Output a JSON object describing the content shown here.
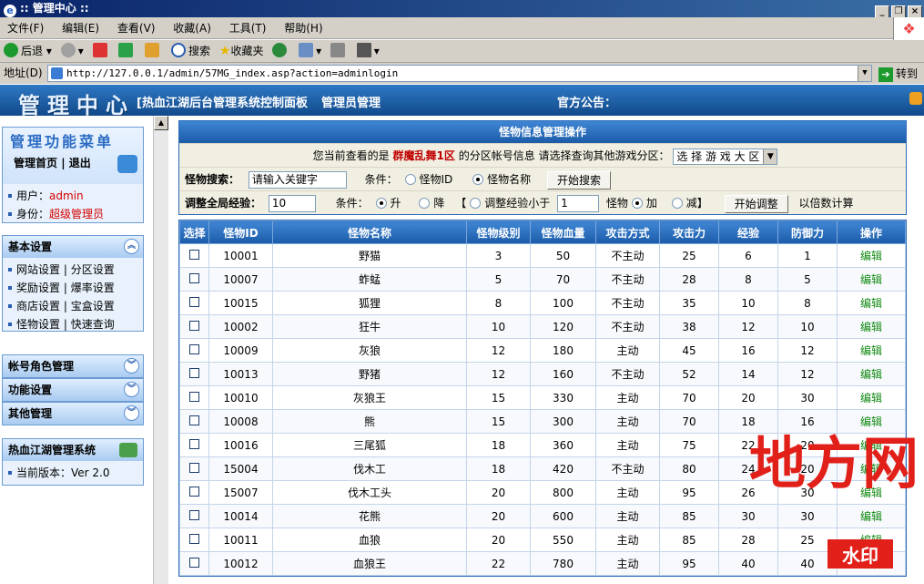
{
  "window": {
    "title": ":: 管理中心 ::",
    "buttons": [
      "_",
      "❐",
      "×"
    ]
  },
  "menubar": [
    "文件(F)",
    "编辑(E)",
    "查看(V)",
    "收藏(A)",
    "工具(T)",
    "帮助(H)"
  ],
  "toolbar": {
    "back": "后退",
    "search": "搜索",
    "favorites": "收藏夹"
  },
  "address": {
    "label": "地址(D)",
    "url": "http://127.0.0.1/admin/57MG_index.asp?action=adminlogin",
    "go": "转到"
  },
  "header": {
    "title": "管理中心",
    "subtitle": "[热血江湖后台管理系统控制面板",
    "admin_link": "管理员管理",
    "notice": "官方公告："
  },
  "sidebar": {
    "menu_title": "管理功能菜单",
    "home": "管理首页",
    "sep": "|",
    "logout": "退出",
    "user_label": "用户：",
    "user_value": "admin",
    "role_label": "身份：",
    "role_value": "超级管理员",
    "basic": {
      "title": "基本设置",
      "links": [
        [
          "网站设置",
          "分区设置"
        ],
        [
          "奖励设置",
          "爆率设置"
        ],
        [
          "商店设置",
          "宝盒设置"
        ],
        [
          "怪物设置",
          "快速查询"
        ]
      ]
    },
    "collapsed": [
      "帐号角色管理",
      "功能设置",
      "其他管理"
    ],
    "system": {
      "title": "热血江湖管理系统",
      "version_label": "当前版本：",
      "version": "Ver 2.0"
    }
  },
  "panel": {
    "title": "怪物信息管理操作",
    "zone_text_pre": "您当前查看的是",
    "zone_name": "群魔乱舞1区",
    "zone_text_post": "的分区帐号信息  请选择查询其他游戏分区：",
    "zone_select": "选 择 游 戏 大 区",
    "search_label": "怪物搜索：",
    "search_placeholder": "请输入关键字",
    "cond_label": "条件：",
    "opt_id": "怪物ID",
    "opt_name": "怪物名称",
    "search_btn": "开始搜索",
    "adjust_label": "调整全局经验：",
    "adjust_value": "10",
    "up": "升",
    "down": "降",
    "bracket_l": "【",
    "less_label": "调整经验小于",
    "less_value": "1",
    "monster": "怪物",
    "add": "加",
    "sub": "减】",
    "adjust_btn": "开始调整",
    "multiplier": "以倍数计算"
  },
  "table": {
    "headers": [
      "选择",
      "怪物ID",
      "怪物名称",
      "怪物级别",
      "怪物血量",
      "攻击方式",
      "攻击力",
      "经验",
      "防御力",
      "操作"
    ],
    "edit_label": "编辑",
    "rows": [
      [
        "10001",
        "野猫",
        "3",
        "50",
        "不主动",
        "25",
        "6",
        "1"
      ],
      [
        "10007",
        "蚱蜢",
        "5",
        "70",
        "不主动",
        "28",
        "8",
        "5"
      ],
      [
        "10015",
        "狐狸",
        "8",
        "100",
        "不主动",
        "35",
        "10",
        "8"
      ],
      [
        "10002",
        "狂牛",
        "10",
        "120",
        "不主动",
        "38",
        "12",
        "10"
      ],
      [
        "10009",
        "灰狼",
        "12",
        "180",
        "主动",
        "45",
        "16",
        "12"
      ],
      [
        "10013",
        "野猪",
        "12",
        "160",
        "不主动",
        "52",
        "14",
        "12"
      ],
      [
        "10010",
        "灰狼王",
        "15",
        "330",
        "主动",
        "70",
        "20",
        "30"
      ],
      [
        "10008",
        "熊",
        "15",
        "300",
        "主动",
        "70",
        "18",
        "16"
      ],
      [
        "10016",
        "三尾狐",
        "18",
        "360",
        "主动",
        "75",
        "22",
        "20"
      ],
      [
        "15004",
        "伐木工",
        "18",
        "420",
        "不主动",
        "80",
        "24",
        "20"
      ],
      [
        "15007",
        "伐木工头",
        "20",
        "800",
        "主动",
        "95",
        "26",
        "30"
      ],
      [
        "10014",
        "花熊",
        "20",
        "600",
        "主动",
        "85",
        "30",
        "30"
      ],
      [
        "10011",
        "血狼",
        "20",
        "550",
        "主动",
        "85",
        "28",
        "25"
      ],
      [
        "10012",
        "血狼王",
        "22",
        "780",
        "主动",
        "95",
        "40",
        "40"
      ]
    ]
  },
  "watermark": {
    "big": "地方网",
    "small": "水印"
  }
}
